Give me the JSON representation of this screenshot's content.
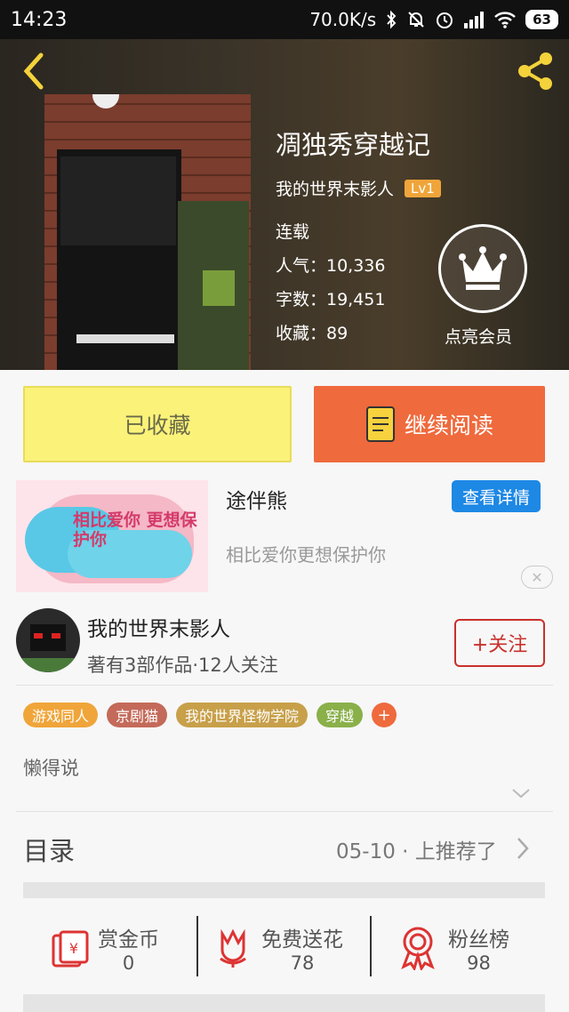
{
  "status_bar": {
    "time": "14:23",
    "network_speed": "70.0K/s",
    "battery": "63"
  },
  "book": {
    "title": "凋独秀穿越记",
    "author": "我的世界末影人",
    "level": "Lv1",
    "status": "连载",
    "popularity": "人气：10,336",
    "word_count": "字数：19,451",
    "favorites": "收藏：89",
    "vip_label": "点亮会员"
  },
  "actions": {
    "collected_label": "已收藏",
    "continue_label": "继续阅读"
  },
  "ad": {
    "title": "途伴熊",
    "detail_label": "查看详情",
    "subtitle": "相比爱你更想保护你",
    "image_text": "相比爱你 更想保护你",
    "close_symbol": "✕"
  },
  "author_card": {
    "name": "我的世界末影人",
    "stats": "著有3部作品·12人关注",
    "follow_label": "+关注"
  },
  "tags": [
    {
      "label": "游戏同人",
      "color": "#f0a53a"
    },
    {
      "label": "京剧猫",
      "color": "#c46a5a"
    },
    {
      "label": "我的世界怪物学院",
      "color": "#c8a04a"
    },
    {
      "label": "穿越",
      "color": "#8ab04a"
    }
  ],
  "tag_add": "+",
  "description": "懒得说",
  "catalog": {
    "label": "目录",
    "update": "05-10 · 上推荐了"
  },
  "stats": {
    "coins_label": "赏金币",
    "coins_value": "0",
    "flowers_label": "免费送花",
    "flowers_value": "78",
    "fans_label": "粉丝榜",
    "fans_value": "98"
  },
  "colors": {
    "accent_orange": "#ef6a3d",
    "accent_red": "#c9302c",
    "collected_yellow": "#fbf27a",
    "ad_blue": "#1e88e5"
  },
  "icons": {
    "back": "chevron-left-icon",
    "share": "share-icon",
    "vip": "crown-icon",
    "book": "book-icon",
    "coins": "red-envelope-icon",
    "flower": "flower-icon",
    "fans": "medal-icon"
  }
}
